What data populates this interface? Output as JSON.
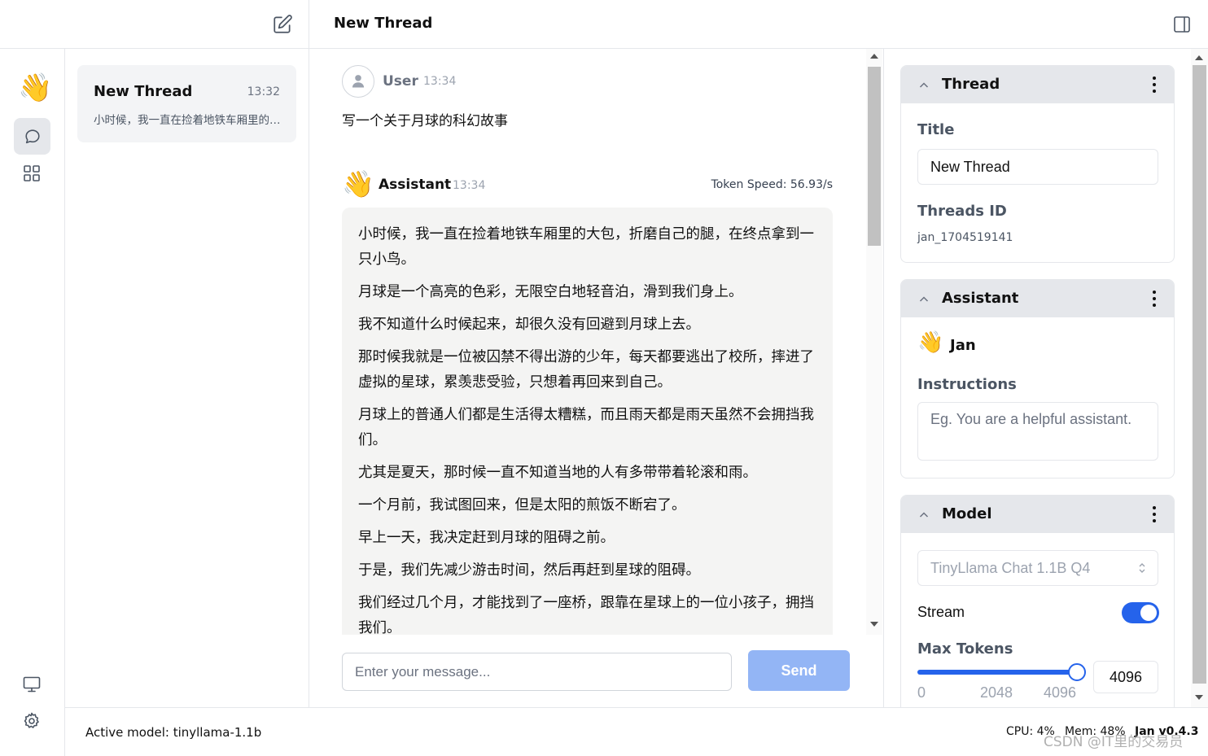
{
  "header": {
    "title": "New Thread"
  },
  "rail": {
    "logo": "👋"
  },
  "threads": [
    {
      "title": "New Thread",
      "time": "13:32",
      "snippet": "小时候，我一直在捡着地铁车厢里的大包..."
    }
  ],
  "chat": {
    "user": {
      "name": "User",
      "time": "13:34",
      "message": "写一个关于月球的科幻故事"
    },
    "assistant": {
      "icon": "👋",
      "name": "Assistant",
      "time": "13:34",
      "token_speed": "Token Speed: 56.93/s",
      "paragraphs": [
        "小时候，我一直在捡着地铁车厢里的大包，折磨自己的腿，在终点拿到一只小鸟。",
        "月球是一个高亮的色彩，无限空白地轻音泊，滑到我们身上。",
        "我不知道什么时候起来，却很久没有回避到月球上去。",
        "那时候我就是一位被囚禁不得出游的少年，每天都要逃出了校所，摔进了虚拟的星球，累羡悲受验，只想着再回来到自己。",
        "月球上的普通人们都是生活得太糟糕，而且雨天都是雨天虽然不会拥挡我们。",
        "尤其是夏天，那时候一直不知道当地的人有多带带着轮滚和雨。",
        "一个月前，我试图回来，但是太阳的煎饭不断宕了。",
        "早上一天，我决定赶到月球的阻碍之前。",
        "于是，我们先减少游击时间，然后再赶到星球的阻碍。",
        "我们经过几个月，才能找到了一座桥，跟靠在星球上的一位小孩子，拥挡我们。"
      ]
    }
  },
  "composer": {
    "placeholder": "Enter your message...",
    "send_label": "Send"
  },
  "panel": {
    "thread": {
      "header": "Thread",
      "title_label": "Title",
      "title_value": "New Thread",
      "id_label": "Threads ID",
      "id_value": "jan_1704519141"
    },
    "assistant": {
      "header": "Assistant",
      "icon": "👋",
      "name": "Jan",
      "instructions_label": "Instructions",
      "instructions_placeholder": "Eg. You are a helpful assistant."
    },
    "model": {
      "header": "Model",
      "selected": "TinyLlama Chat 1.1B Q4",
      "stream_label": "Stream",
      "stream_on": true,
      "max_tokens_label": "Max Tokens",
      "max_tokens_value": "4096",
      "slider_fraction": 1.0,
      "ticks": [
        "0",
        "2048",
        "4096"
      ]
    }
  },
  "status": {
    "active_model": "Active model: tinyllama-1.1b",
    "cpu": "CPU: 4%",
    "mem": "Mem: 48%",
    "version": "Jan v0.4.3"
  },
  "watermark": "CSDN @IT里的交易员",
  "colors": {
    "accent": "#2563eb",
    "send_disabled": "#93b5f5",
    "card_header": "#e5e7eb",
    "reply_bg": "#f4f4f3"
  },
  "icons": [
    "edit-icon",
    "panel-toggle-icon",
    "chat-icon",
    "grid-icon",
    "monitor-icon",
    "gear-icon",
    "user-icon",
    "chevron-up-icon",
    "more-vertical-icon",
    "updown-icon"
  ]
}
